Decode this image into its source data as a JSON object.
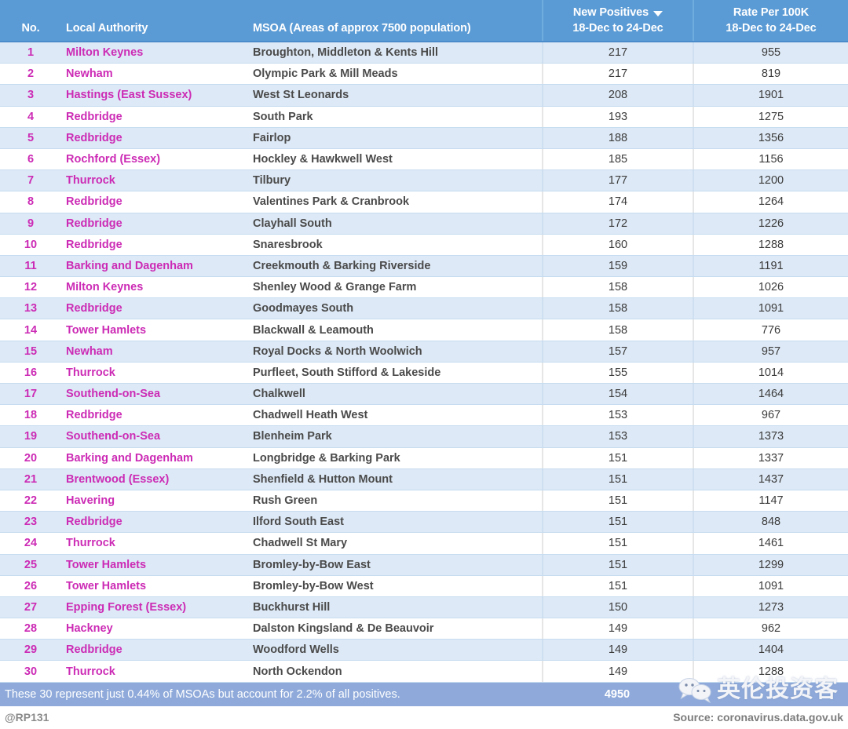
{
  "header": {
    "columns": [
      {
        "top": "",
        "bottom": "No.",
        "key": "no"
      },
      {
        "top": "",
        "bottom": "Local Authority",
        "key": "la"
      },
      {
        "top": "",
        "bottom": "MSOA (Areas of approx 7500 population)",
        "key": "msoa"
      },
      {
        "top": "New Positives",
        "bottom": "18-Dec to 24-Dec",
        "key": "new",
        "sort_icon": "caret-down-icon"
      },
      {
        "top": "Rate Per 100K",
        "bottom": "18-Dec to 24-Dec",
        "key": "rate"
      }
    ]
  },
  "rows": [
    {
      "no": "1",
      "la": "Milton Keynes",
      "msoa": "Broughton, Middleton & Kents Hill",
      "new": "217",
      "rate": "955"
    },
    {
      "no": "2",
      "la": "Newham",
      "msoa": "Olympic Park & Mill Meads",
      "new": "217",
      "rate": "819"
    },
    {
      "no": "3",
      "la": "Hastings (East Sussex)",
      "msoa": "West St Leonards",
      "new": "208",
      "rate": "1901"
    },
    {
      "no": "4",
      "la": "Redbridge",
      "msoa": "South Park",
      "new": "193",
      "rate": "1275"
    },
    {
      "no": "5",
      "la": "Redbridge",
      "msoa": "Fairlop",
      "new": "188",
      "rate": "1356"
    },
    {
      "no": "6",
      "la": "Rochford (Essex)",
      "msoa": "Hockley & Hawkwell West",
      "new": "185",
      "rate": "1156"
    },
    {
      "no": "7",
      "la": "Thurrock",
      "msoa": "Tilbury",
      "new": "177",
      "rate": "1200"
    },
    {
      "no": "8",
      "la": "Redbridge",
      "msoa": "Valentines Park & Cranbrook",
      "new": "174",
      "rate": "1264"
    },
    {
      "no": "9",
      "la": "Redbridge",
      "msoa": "Clayhall South",
      "new": "172",
      "rate": "1226"
    },
    {
      "no": "10",
      "la": "Redbridge",
      "msoa": "Snaresbrook",
      "new": "160",
      "rate": "1288"
    },
    {
      "no": "11",
      "la": "Barking and Dagenham",
      "msoa": "Creekmouth & Barking Riverside",
      "new": "159",
      "rate": "1191"
    },
    {
      "no": "12",
      "la": "Milton Keynes",
      "msoa": "Shenley Wood & Grange Farm",
      "new": "158",
      "rate": "1026"
    },
    {
      "no": "13",
      "la": "Redbridge",
      "msoa": "Goodmayes South",
      "new": "158",
      "rate": "1091"
    },
    {
      "no": "14",
      "la": "Tower Hamlets",
      "msoa": "Blackwall & Leamouth",
      "new": "158",
      "rate": "776"
    },
    {
      "no": "15",
      "la": "Newham",
      "msoa": "Royal Docks & North Woolwich",
      "new": "157",
      "rate": "957"
    },
    {
      "no": "16",
      "la": "Thurrock",
      "msoa": "Purfleet, South Stifford & Lakeside",
      "new": "155",
      "rate": "1014"
    },
    {
      "no": "17",
      "la": "Southend-on-Sea",
      "msoa": "Chalkwell",
      "new": "154",
      "rate": "1464"
    },
    {
      "no": "18",
      "la": "Redbridge",
      "msoa": "Chadwell Heath West",
      "new": "153",
      "rate": "967"
    },
    {
      "no": "19",
      "la": "Southend-on-Sea",
      "msoa": "Blenheim Park",
      "new": "153",
      "rate": "1373"
    },
    {
      "no": "20",
      "la": "Barking and Dagenham",
      "msoa": "Longbridge & Barking Park",
      "new": "151",
      "rate": "1337"
    },
    {
      "no": "21",
      "la": "Brentwood (Essex)",
      "msoa": "Shenfield & Hutton Mount",
      "new": "151",
      "rate": "1437"
    },
    {
      "no": "22",
      "la": "Havering",
      "msoa": "Rush Green",
      "new": "151",
      "rate": "1147"
    },
    {
      "no": "23",
      "la": "Redbridge",
      "msoa": "Ilford South East",
      "new": "151",
      "rate": "848"
    },
    {
      "no": "24",
      "la": "Thurrock",
      "msoa": "Chadwell St Mary",
      "new": "151",
      "rate": "1461"
    },
    {
      "no": "25",
      "la": "Tower Hamlets",
      "msoa": "Bromley-by-Bow East",
      "new": "151",
      "rate": "1299"
    },
    {
      "no": "26",
      "la": "Tower Hamlets",
      "msoa": "Bromley-by-Bow West",
      "new": "151",
      "rate": "1091"
    },
    {
      "no": "27",
      "la": "Epping Forest (Essex)",
      "msoa": "Buckhurst Hill",
      "new": "150",
      "rate": "1273"
    },
    {
      "no": "28",
      "la": "Hackney",
      "msoa": "Dalston Kingsland & De Beauvoir",
      "new": "149",
      "rate": "962"
    },
    {
      "no": "29",
      "la": "Redbridge",
      "msoa": "Woodford Wells",
      "new": "149",
      "rate": "1404"
    },
    {
      "no": "30",
      "la": "Thurrock",
      "msoa": "North Ockendon",
      "new": "149",
      "rate": "1288"
    }
  ],
  "summary": {
    "text": "These 30 represent just 0.44% of MSOAs but account for 2.2% of all positives.",
    "total": "4950"
  },
  "footer": {
    "handle": "@RP131",
    "source": "Source: coronavirus.data.gov.uk"
  },
  "watermark": {
    "text": "英伦投资客",
    "logo": "wechat-bubbles-icon"
  },
  "colors": {
    "header_bg": "#5b9bd5",
    "row_odd_bg": "#dde9f6",
    "row_even_bg": "#ffffff",
    "authority_text": "#cc2bb5",
    "msoa_text": "#4a4a4a",
    "summary_bg": "#8faada",
    "grid_line": "#c6dcf0"
  }
}
